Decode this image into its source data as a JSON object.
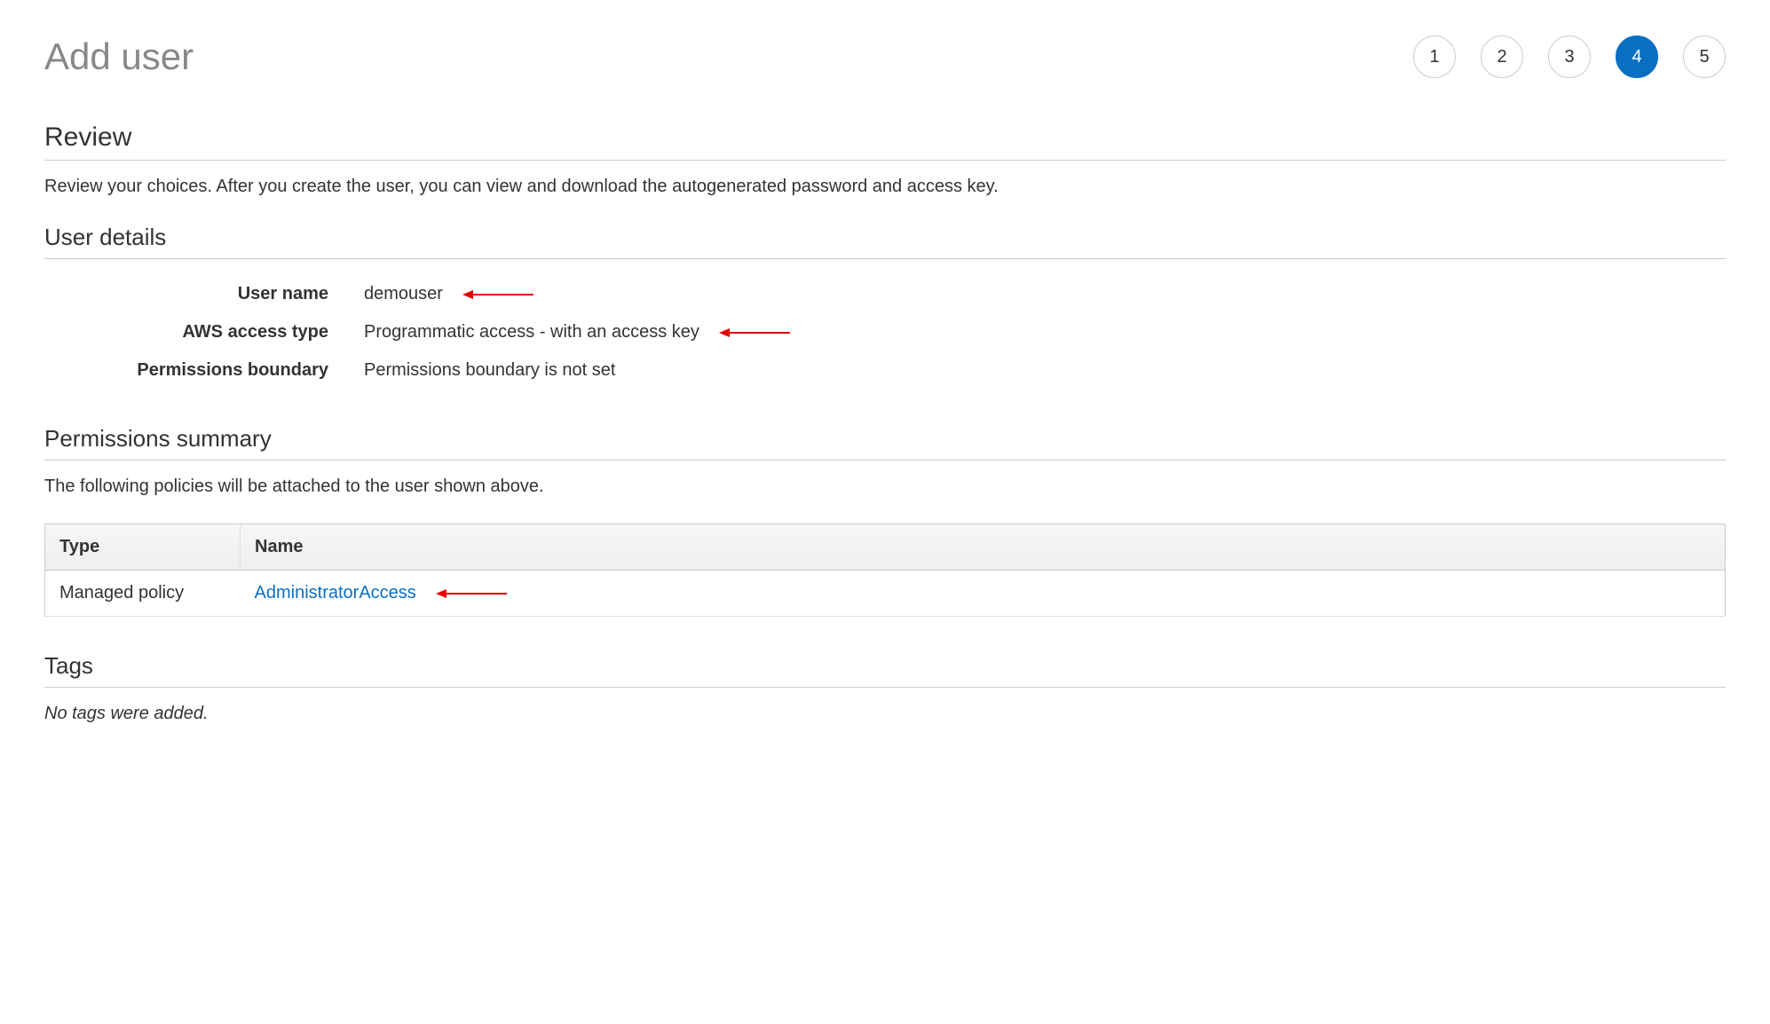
{
  "header": {
    "title": "Add user",
    "steps": [
      "1",
      "2",
      "3",
      "4",
      "5"
    ],
    "active_step_index": 3
  },
  "review": {
    "heading": "Review",
    "description": "Review your choices. After you create the user, you can view and download the autogenerated password and access key."
  },
  "user_details": {
    "heading": "User details",
    "rows": {
      "user_name": {
        "label": "User name",
        "value": "demouser"
      },
      "access_type": {
        "label": "AWS access type",
        "value": "Programmatic access - with an access key"
      },
      "permissions_boundary": {
        "label": "Permissions boundary",
        "value": "Permissions boundary is not set"
      }
    }
  },
  "permissions_summary": {
    "heading": "Permissions summary",
    "description": "The following policies will be attached to the user shown above.",
    "table": {
      "headers": {
        "type": "Type",
        "name": "Name"
      },
      "rows": [
        {
          "type": "Managed policy",
          "name": "AdministratorAccess"
        }
      ]
    }
  },
  "tags": {
    "heading": "Tags",
    "empty_text": "No tags were added."
  }
}
